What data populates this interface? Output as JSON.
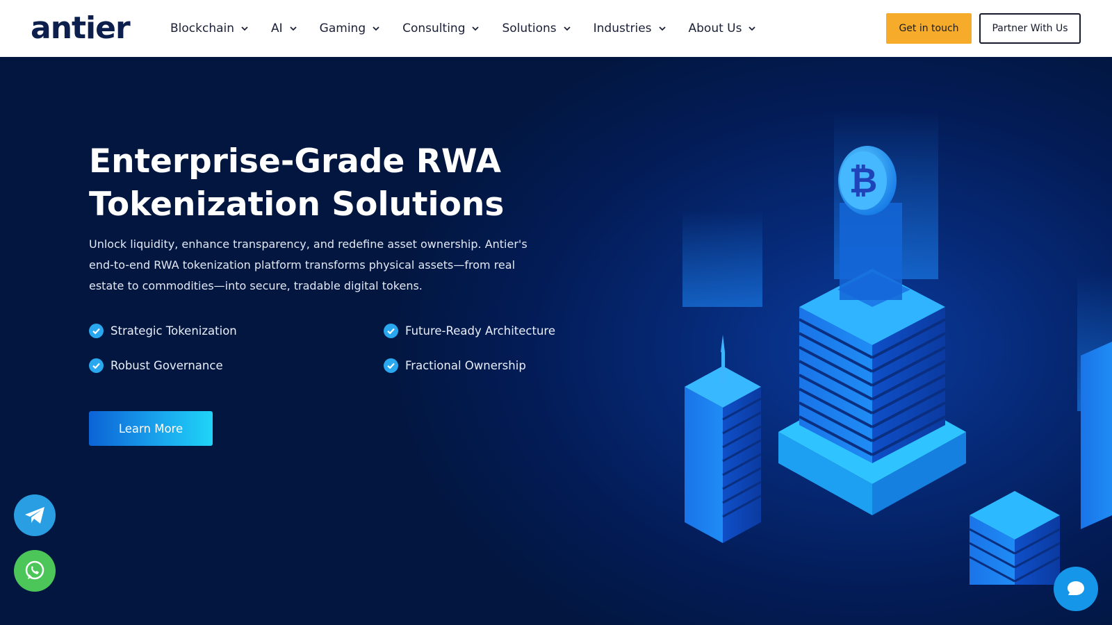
{
  "brand": {
    "logo_text": "antier"
  },
  "nav": {
    "items": [
      {
        "label": "Blockchain"
      },
      {
        "label": "AI"
      },
      {
        "label": "Gaming"
      },
      {
        "label": "Consulting"
      },
      {
        "label": "Solutions"
      },
      {
        "label": "Industries"
      },
      {
        "label": "About Us"
      }
    ]
  },
  "header_actions": {
    "get_in_touch": "Get in touch",
    "partner": "Partner With Us"
  },
  "hero": {
    "title_line1": "Enterprise-Grade RWA",
    "title_line2": "Tokenization Solutions",
    "description": "Unlock liquidity, enhance transparency, and redefine asset ownership. Antier's end-to-end RWA tokenization platform transforms physical assets—from real estate to commodities—into secure, tradable digital tokens.",
    "features": [
      "Strategic Tokenization",
      "Future-Ready Architecture",
      "Robust Governance",
      "Fractional Ownership"
    ],
    "cta": "Learn More"
  },
  "floating": {
    "telegram_icon": "telegram-icon",
    "whatsapp_icon": "whatsapp-icon",
    "chat_icon": "chat-icon"
  },
  "colors": {
    "accent_orange": "#f7ab2a",
    "hero_bg": "#031c57",
    "check_blue": "#2aa8ef"
  }
}
